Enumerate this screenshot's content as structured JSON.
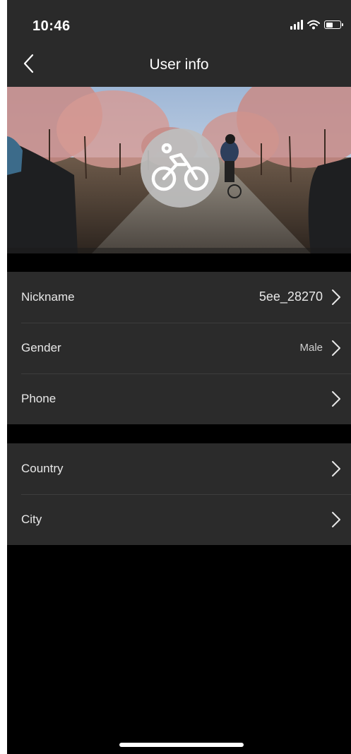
{
  "status_bar": {
    "time": "10:46"
  },
  "nav": {
    "title": "User info"
  },
  "profile": {
    "avatar_icon": "bicycle-icon"
  },
  "groups": [
    {
      "rows": [
        {
          "label": "Nickname",
          "value": "5ee_28270"
        },
        {
          "label": "Gender",
          "value": "Male"
        },
        {
          "label": "Phone",
          "value": ""
        }
      ]
    },
    {
      "rows": [
        {
          "label": "Country",
          "value": ""
        },
        {
          "label": "City",
          "value": ""
        }
      ]
    }
  ],
  "colors": {
    "background": "#000000",
    "header": "#2a2a2a",
    "row_background": "#2b2b2b",
    "text": "#e8e8e8",
    "avatar_circle": "#bebebe"
  }
}
